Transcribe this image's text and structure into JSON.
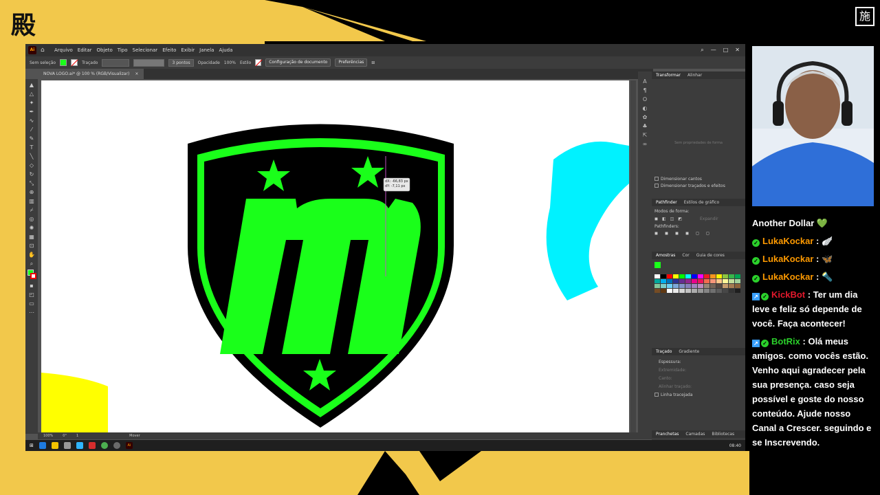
{
  "overlay": {
    "logo_glyph": "殿",
    "corner_glyph": "施"
  },
  "app": {
    "badge": "Ai",
    "menus": [
      "Arquivo",
      "Editar",
      "Objeto",
      "Tipo",
      "Selecionar",
      "Efeito",
      "Exibir",
      "Janela",
      "Ajuda"
    ],
    "control": {
      "selection": "Sem seleção",
      "stroke_label": "Traçado",
      "brush": "3 pontos",
      "opacity_label": "Opacidade",
      "opacity_value": "100%",
      "style_label": "Estilo",
      "doc_setup": "Configuração de documento",
      "prefs": "Preferências"
    },
    "doc_tab": "NOVA LOGO.ai* @ 100 % (RGB/Visualizar)",
    "tooltip": [
      "dX: -66,83 px",
      "dY: -7,11 px"
    ],
    "status": {
      "zoom": "100%",
      "rotation": "0°",
      "artboard": "1",
      "tool": "Mover"
    },
    "panels": {
      "transform_tabs": [
        "Transformar",
        "Alinhar"
      ],
      "no_props": "Sem propriedades de forma",
      "scale_corners": "Dimensionar cantos",
      "scale_strokes": "Dimensionar traçados e efeitos",
      "pathfinder_tabs": [
        "Pathfinder",
        "Estilos de gráfico"
      ],
      "shape_modes": "Modos de forma:",
      "expand": "Expandir",
      "pathfinders": "Pathfinders:",
      "swatch_tabs": [
        "Amostras",
        "Cor",
        "Guia de cores"
      ],
      "stroke_tabs": [
        "Traçado",
        "Gradiente"
      ],
      "stroke_fields": [
        "Espessura:",
        "Extremidade:",
        "Canto:",
        "Alinhar traçado:"
      ],
      "dashed": "Linha tracejada",
      "bottom_tabs": [
        "Pranchetas",
        "Camadas",
        "Bibliotecas"
      ]
    },
    "swatch_colors": [
      "#ffffff",
      "#000000",
      "#ff0000",
      "#ffff00",
      "#00ff00",
      "#00ffff",
      "#0000ff",
      "#ff00ff",
      "#ed1c24",
      "#f7941d",
      "#fff200",
      "#8dc63f",
      "#39b54a",
      "#00a651",
      "#00a99d",
      "#00aeef",
      "#0072bc",
      "#2e3192",
      "#662d91",
      "#92278f",
      "#ec008c",
      "#ed145b",
      "#f26c4f",
      "#f69679",
      "#fdc689",
      "#fff799",
      "#c4df9b",
      "#a3d39c",
      "#82ca9c",
      "#7accc8",
      "#6dcff6",
      "#7da7d9",
      "#8393ca",
      "#8781bd",
      "#a186be",
      "#bd8cbf",
      "#998675",
      "#736357",
      "#534741",
      "#c69c6d",
      "#a67c52",
      "#8c6239",
      "#754c24",
      "#603913",
      "#ffffff",
      "#ebebeb",
      "#d6d6d6",
      "#c2c2c2",
      "#adadad",
      "#999999",
      "#858585",
      "#707070",
      "#5c5c5c",
      "#474747",
      "#333333",
      "#1f1f1f"
    ],
    "clock": "08:40"
  },
  "chat": [
    {
      "type": "partial",
      "text": "Another Dollar 💚"
    },
    {
      "user": "LukaKockar",
      "color": "orange",
      "badge": "check",
      "msg": "🪽"
    },
    {
      "user": "LukaKockar",
      "color": "orange",
      "badge": "check",
      "msg": "🦋"
    },
    {
      "user": "LukaKockar",
      "color": "orange",
      "badge": "check",
      "msg": "🔦"
    },
    {
      "user": "KickBot",
      "color": "red",
      "badge": "bot",
      "msg": "Ter um dia leve e feliz só depende de você. Faça acontecer!"
    },
    {
      "user": "BotRix",
      "color": "green",
      "badge": "bot",
      "msg": "Olá meus amigos. como vocês estão. Venho aqui agradecer pela sua presença. caso seja possível e goste do nosso conteúdo. Ajude nosso Canal a Crescer. seguindo e se Inscrevendo."
    }
  ],
  "colors": {
    "logo_green": "#1aff1a",
    "logo_black": "#000000",
    "cyan": "#00f2ff",
    "yellow": "#ffff00"
  }
}
